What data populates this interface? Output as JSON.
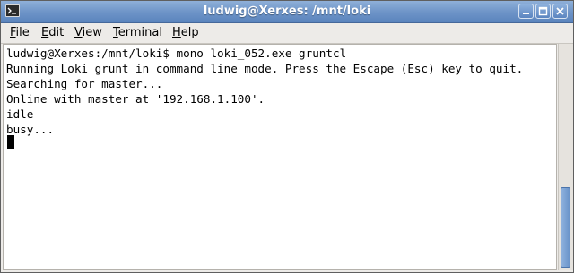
{
  "window": {
    "title": "ludwig@Xerxes: /mnt/loki",
    "controls": [
      "minimize-icon",
      "maximize-icon",
      "close-icon"
    ]
  },
  "menubar": {
    "items": [
      {
        "first": "F",
        "rest": "ile"
      },
      {
        "first": "E",
        "rest": "dit"
      },
      {
        "first": "V",
        "rest": "iew"
      },
      {
        "first": "T",
        "rest": "erminal"
      },
      {
        "first": "H",
        "rest": "elp"
      }
    ]
  },
  "terminal": {
    "lines": [
      "ludwig@Xerxes:/mnt/loki$ mono loki_052.exe gruntcl",
      "Running Loki grunt in command line mode. Press the Escape (Esc) key to quit.",
      "Searching for master...",
      "Online with master at '192.168.1.100'.",
      "idle",
      "busy..."
    ]
  },
  "colors": {
    "titlebar": "#6f95c8",
    "terminal_bg": "#ffffff",
    "terminal_fg": "#000000"
  }
}
